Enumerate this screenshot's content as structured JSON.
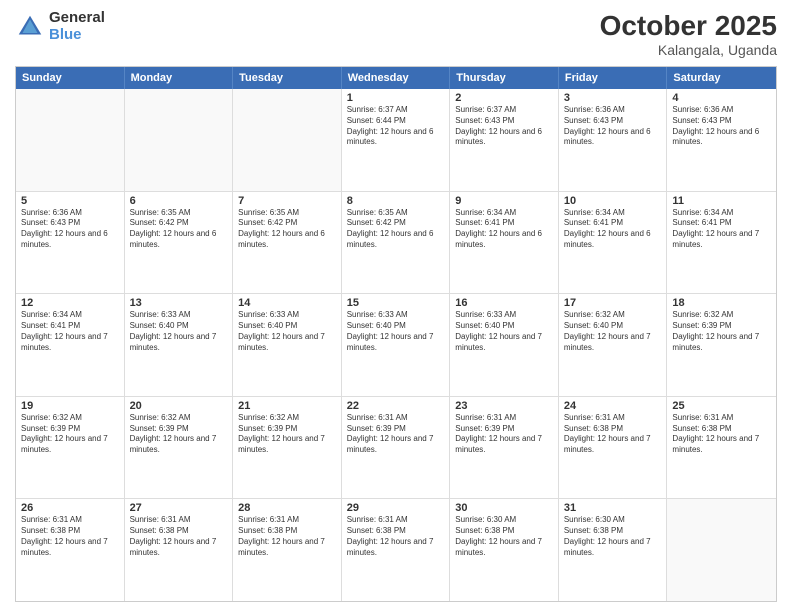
{
  "logo": {
    "general": "General",
    "blue": "Blue"
  },
  "header": {
    "month": "October 2025",
    "location": "Kalangala, Uganda"
  },
  "days": [
    "Sunday",
    "Monday",
    "Tuesday",
    "Wednesday",
    "Thursday",
    "Friday",
    "Saturday"
  ],
  "rows": [
    [
      {
        "day": "",
        "empty": true
      },
      {
        "day": "",
        "empty": true
      },
      {
        "day": "",
        "empty": true
      },
      {
        "day": "1",
        "sunrise": "Sunrise: 6:37 AM",
        "sunset": "Sunset: 6:44 PM",
        "daylight": "Daylight: 12 hours and 6 minutes."
      },
      {
        "day": "2",
        "sunrise": "Sunrise: 6:37 AM",
        "sunset": "Sunset: 6:43 PM",
        "daylight": "Daylight: 12 hours and 6 minutes."
      },
      {
        "day": "3",
        "sunrise": "Sunrise: 6:36 AM",
        "sunset": "Sunset: 6:43 PM",
        "daylight": "Daylight: 12 hours and 6 minutes."
      },
      {
        "day": "4",
        "sunrise": "Sunrise: 6:36 AM",
        "sunset": "Sunset: 6:43 PM",
        "daylight": "Daylight: 12 hours and 6 minutes."
      }
    ],
    [
      {
        "day": "5",
        "sunrise": "Sunrise: 6:36 AM",
        "sunset": "Sunset: 6:43 PM",
        "daylight": "Daylight: 12 hours and 6 minutes."
      },
      {
        "day": "6",
        "sunrise": "Sunrise: 6:35 AM",
        "sunset": "Sunset: 6:42 PM",
        "daylight": "Daylight: 12 hours and 6 minutes."
      },
      {
        "day": "7",
        "sunrise": "Sunrise: 6:35 AM",
        "sunset": "Sunset: 6:42 PM",
        "daylight": "Daylight: 12 hours and 6 minutes."
      },
      {
        "day": "8",
        "sunrise": "Sunrise: 6:35 AM",
        "sunset": "Sunset: 6:42 PM",
        "daylight": "Daylight: 12 hours and 6 minutes."
      },
      {
        "day": "9",
        "sunrise": "Sunrise: 6:34 AM",
        "sunset": "Sunset: 6:41 PM",
        "daylight": "Daylight: 12 hours and 6 minutes."
      },
      {
        "day": "10",
        "sunrise": "Sunrise: 6:34 AM",
        "sunset": "Sunset: 6:41 PM",
        "daylight": "Daylight: 12 hours and 6 minutes."
      },
      {
        "day": "11",
        "sunrise": "Sunrise: 6:34 AM",
        "sunset": "Sunset: 6:41 PM",
        "daylight": "Daylight: 12 hours and 7 minutes."
      }
    ],
    [
      {
        "day": "12",
        "sunrise": "Sunrise: 6:34 AM",
        "sunset": "Sunset: 6:41 PM",
        "daylight": "Daylight: 12 hours and 7 minutes."
      },
      {
        "day": "13",
        "sunrise": "Sunrise: 6:33 AM",
        "sunset": "Sunset: 6:40 PM",
        "daylight": "Daylight: 12 hours and 7 minutes."
      },
      {
        "day": "14",
        "sunrise": "Sunrise: 6:33 AM",
        "sunset": "Sunset: 6:40 PM",
        "daylight": "Daylight: 12 hours and 7 minutes."
      },
      {
        "day": "15",
        "sunrise": "Sunrise: 6:33 AM",
        "sunset": "Sunset: 6:40 PM",
        "daylight": "Daylight: 12 hours and 7 minutes."
      },
      {
        "day": "16",
        "sunrise": "Sunrise: 6:33 AM",
        "sunset": "Sunset: 6:40 PM",
        "daylight": "Daylight: 12 hours and 7 minutes."
      },
      {
        "day": "17",
        "sunrise": "Sunrise: 6:32 AM",
        "sunset": "Sunset: 6:40 PM",
        "daylight": "Daylight: 12 hours and 7 minutes."
      },
      {
        "day": "18",
        "sunrise": "Sunrise: 6:32 AM",
        "sunset": "Sunset: 6:39 PM",
        "daylight": "Daylight: 12 hours and 7 minutes."
      }
    ],
    [
      {
        "day": "19",
        "sunrise": "Sunrise: 6:32 AM",
        "sunset": "Sunset: 6:39 PM",
        "daylight": "Daylight: 12 hours and 7 minutes."
      },
      {
        "day": "20",
        "sunrise": "Sunrise: 6:32 AM",
        "sunset": "Sunset: 6:39 PM",
        "daylight": "Daylight: 12 hours and 7 minutes."
      },
      {
        "day": "21",
        "sunrise": "Sunrise: 6:32 AM",
        "sunset": "Sunset: 6:39 PM",
        "daylight": "Daylight: 12 hours and 7 minutes."
      },
      {
        "day": "22",
        "sunrise": "Sunrise: 6:31 AM",
        "sunset": "Sunset: 6:39 PM",
        "daylight": "Daylight: 12 hours and 7 minutes."
      },
      {
        "day": "23",
        "sunrise": "Sunrise: 6:31 AM",
        "sunset": "Sunset: 6:39 PM",
        "daylight": "Daylight: 12 hours and 7 minutes."
      },
      {
        "day": "24",
        "sunrise": "Sunrise: 6:31 AM",
        "sunset": "Sunset: 6:38 PM",
        "daylight": "Daylight: 12 hours and 7 minutes."
      },
      {
        "day": "25",
        "sunrise": "Sunrise: 6:31 AM",
        "sunset": "Sunset: 6:38 PM",
        "daylight": "Daylight: 12 hours and 7 minutes."
      }
    ],
    [
      {
        "day": "26",
        "sunrise": "Sunrise: 6:31 AM",
        "sunset": "Sunset: 6:38 PM",
        "daylight": "Daylight: 12 hours and 7 minutes."
      },
      {
        "day": "27",
        "sunrise": "Sunrise: 6:31 AM",
        "sunset": "Sunset: 6:38 PM",
        "daylight": "Daylight: 12 hours and 7 minutes."
      },
      {
        "day": "28",
        "sunrise": "Sunrise: 6:31 AM",
        "sunset": "Sunset: 6:38 PM",
        "daylight": "Daylight: 12 hours and 7 minutes."
      },
      {
        "day": "29",
        "sunrise": "Sunrise: 6:31 AM",
        "sunset": "Sunset: 6:38 PM",
        "daylight": "Daylight: 12 hours and 7 minutes."
      },
      {
        "day": "30",
        "sunrise": "Sunrise: 6:30 AM",
        "sunset": "Sunset: 6:38 PM",
        "daylight": "Daylight: 12 hours and 7 minutes."
      },
      {
        "day": "31",
        "sunrise": "Sunrise: 6:30 AM",
        "sunset": "Sunset: 6:38 PM",
        "daylight": "Daylight: 12 hours and 7 minutes."
      },
      {
        "day": "",
        "empty": true
      }
    ]
  ]
}
